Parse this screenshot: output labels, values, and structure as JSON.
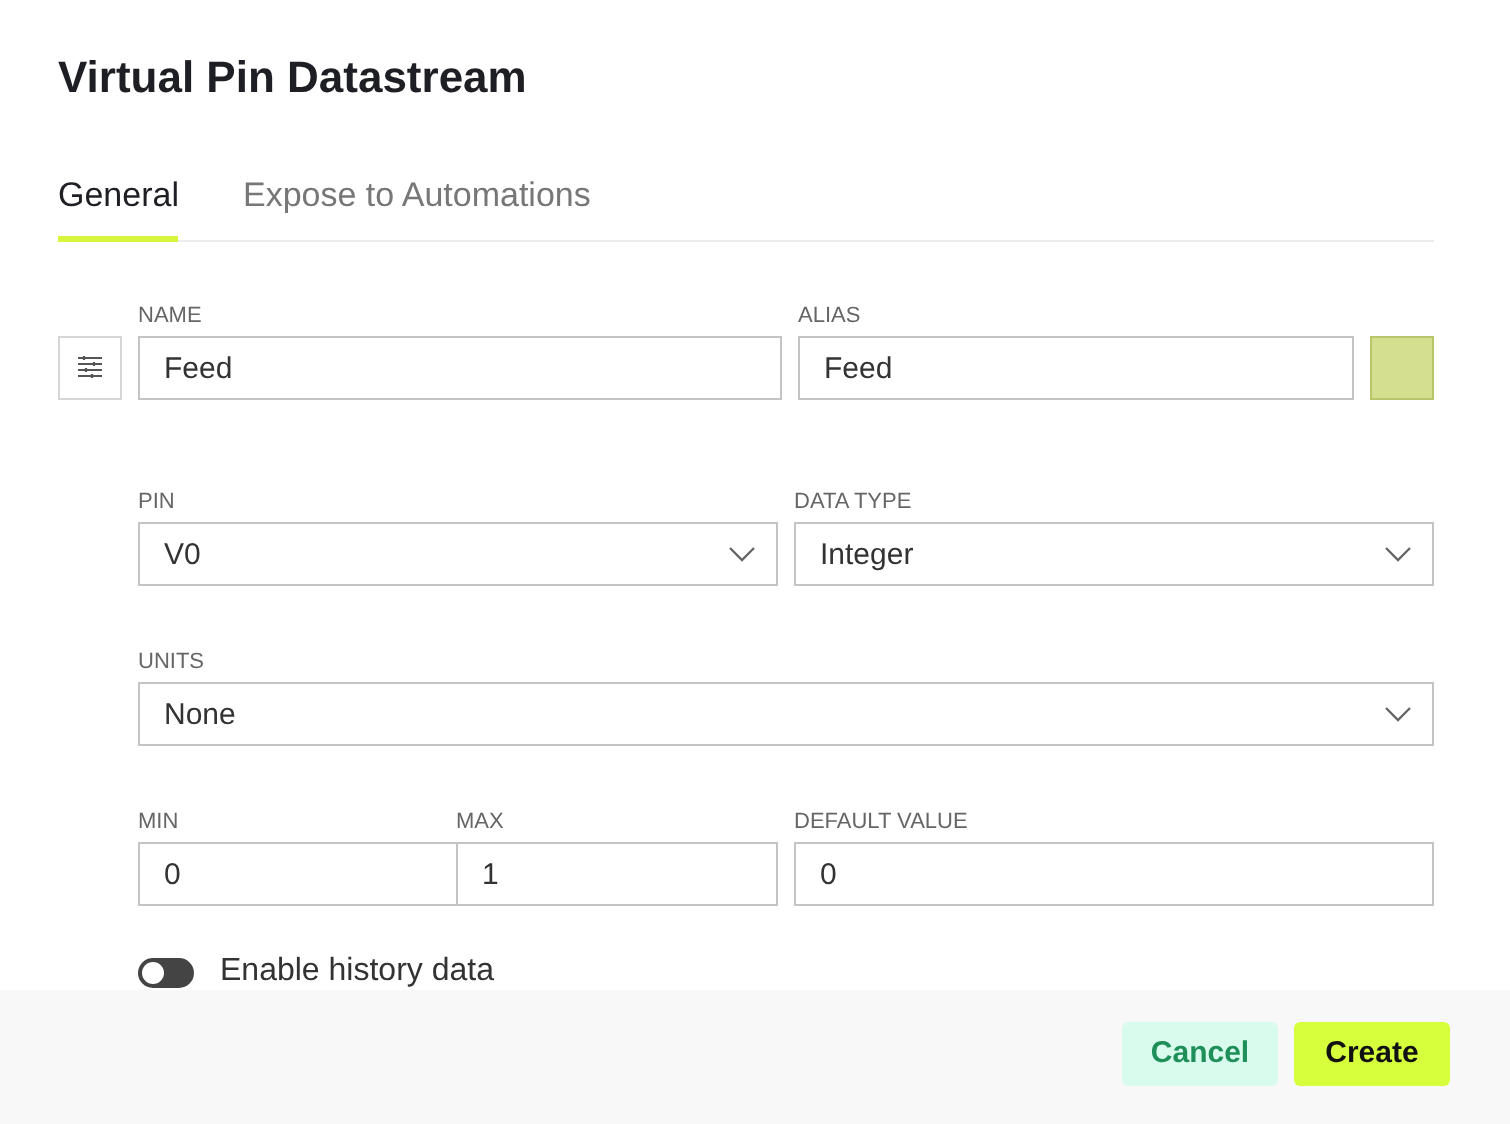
{
  "dialog": {
    "title": "Virtual Pin Datastream"
  },
  "tabs": [
    {
      "label": "General",
      "selected": true
    },
    {
      "label": "Expose to Automations",
      "selected": false
    }
  ],
  "rows": [
    {
      "fields": [
        {
          "kind": "text",
          "label": "NAME",
          "value": "Feed"
        },
        {
          "kind": "text",
          "label": "ALIAS",
          "value": "Feed"
        },
        {
          "kind": "color",
          "color": "#d4e08f"
        }
      ]
    },
    {
      "fields": [
        {
          "kind": "select",
          "label": "PIN",
          "value": "V0"
        },
        {
          "kind": "select",
          "label": "DATA TYPE",
          "value": "Integer"
        }
      ]
    },
    {
      "fields": [
        {
          "kind": "select",
          "label": "UNITS",
          "value": "None"
        }
      ]
    },
    {
      "fields": [
        {
          "kind": "text",
          "label": "MIN",
          "value": "0"
        },
        {
          "kind": "text",
          "label": "MAX",
          "value": "1"
        },
        {
          "kind": "text",
          "label": "DEFAULT VALUE",
          "value": "0"
        }
      ]
    }
  ],
  "history_toggle": {
    "label": "Enable history data",
    "on": false
  },
  "buttons": [
    {
      "kind": "secondary",
      "label": "Cancel"
    },
    {
      "kind": "primary",
      "label": "Create"
    }
  ]
}
